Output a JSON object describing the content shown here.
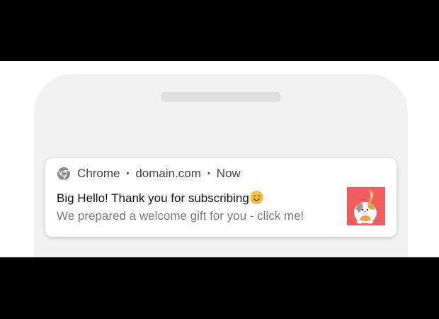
{
  "notification": {
    "app_name": "Chrome",
    "domain": "domain.com",
    "time": "Now",
    "separator": "•",
    "title": "Big Hello! Thank you for subscribing",
    "body": "We prepared a welcome gift for you - click me!",
    "emoji_icon": "smiling-face-emoji",
    "app_icon": "chrome-icon",
    "thumbnail_background": "#f25c5c"
  }
}
